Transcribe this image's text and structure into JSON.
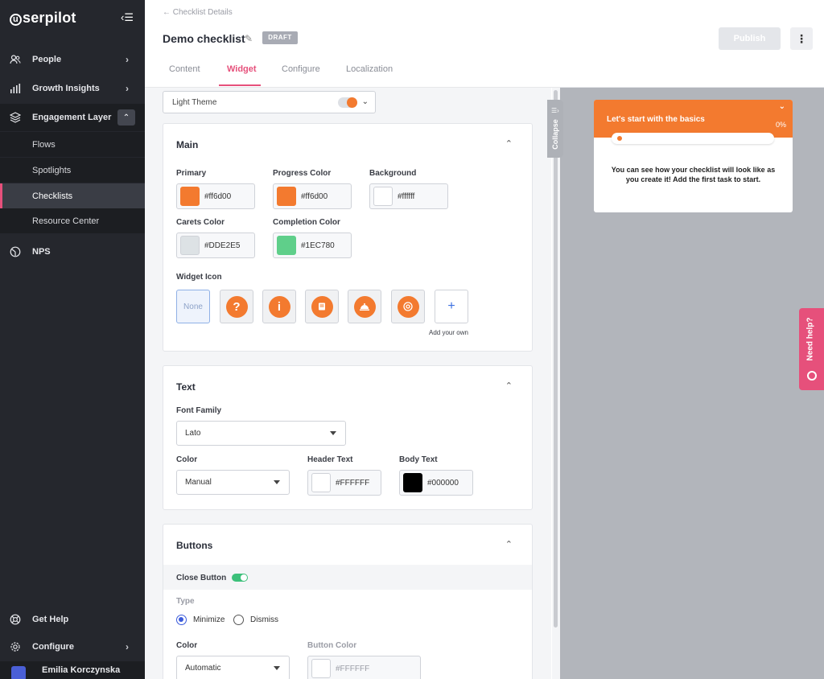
{
  "sidebar": {
    "logo": "serpilot",
    "logo_letter": "u",
    "collapse_icon": "‹☰",
    "items": [
      {
        "label": "People"
      },
      {
        "label": "Growth Insights"
      },
      {
        "label": "Engagement Layer"
      }
    ],
    "sub_items": [
      {
        "label": "Flows"
      },
      {
        "label": "Spotlights"
      },
      {
        "label": "Checklists"
      },
      {
        "label": "Resource Center"
      }
    ],
    "nps": "NPS",
    "get_help": "Get Help",
    "configure": "Configure",
    "user": "Emilia Korczynska"
  },
  "header": {
    "breadcrumb": "← Checklist Details",
    "title": "Demo checklist",
    "status": "DRAFT",
    "publish": "Publish",
    "tabs": [
      "Content",
      "Widget",
      "Configure",
      "Localization"
    ],
    "active_tab": "Widget"
  },
  "theme": {
    "value": "Light Theme"
  },
  "main_card": {
    "title": "Main",
    "primary": {
      "label": "Primary",
      "value": "#ff6d00",
      "swatch": "#f37a2f"
    },
    "progress": {
      "label": "Progress Color",
      "value": "#ff6d00",
      "swatch": "#f37a2f"
    },
    "background": {
      "label": "Background",
      "value": "#ffffff",
      "swatch": "#ffffff"
    },
    "carets": {
      "label": "Carets Color",
      "value": "#DDE2E5",
      "swatch": "#dde2e5"
    },
    "completion": {
      "label": "Completion Color",
      "value": "#1EC780",
      "swatch": "#5fcf8a"
    },
    "widget_icon": {
      "label": "Widget Icon",
      "none": "None",
      "add": "+",
      "add_own": "Add your own"
    }
  },
  "text_card": {
    "title": "Text",
    "font_family_label": "Font Family",
    "font_family": "Lato",
    "color_label": "Color",
    "color_mode": "Manual",
    "header_text_label": "Header Text",
    "header_text": "#FFFFFF",
    "body_text_label": "Body Text",
    "body_text": "#000000"
  },
  "buttons_card": {
    "title": "Buttons",
    "close_button": "Close Button",
    "type_label": "Type",
    "minimize": "Minimize",
    "dismiss": "Dismiss",
    "color_label": "Color",
    "color_mode": "Automatic",
    "button_color_label": "Button Color",
    "button_color": "#FFFFFF"
  },
  "preview": {
    "collapse": "Collapse",
    "widget_title": "Let's start with the basics",
    "progress_pct": "0%",
    "body": "You can see how your checklist will look like as you create it! Add the first task to start.",
    "need_help": "Need help?"
  },
  "colors": {
    "accent": "#e6507b",
    "brand_orange": "#f37a2f",
    "sidebar_bg": "#25272d"
  }
}
